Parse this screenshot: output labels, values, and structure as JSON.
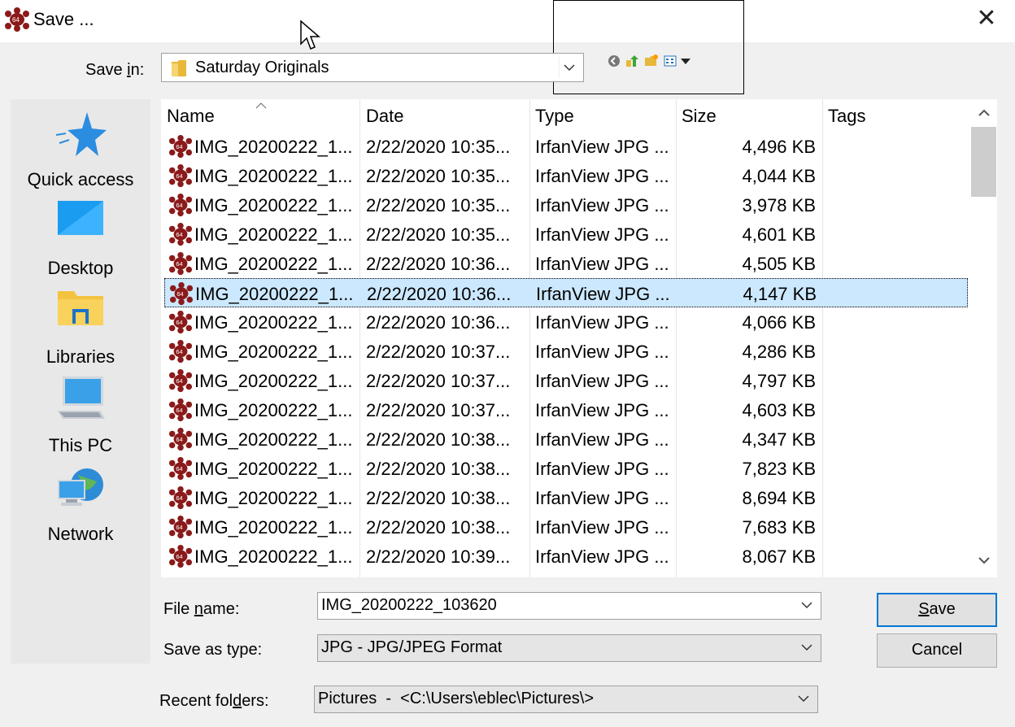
{
  "window": {
    "title": "Save ...",
    "close_label": "✕"
  },
  "save_in": {
    "label_pre": "Save ",
    "label_key": "i",
    "label_post": "n:",
    "value": "Saturday Originals"
  },
  "toolbar": {
    "icons": [
      "back-icon",
      "up-folder-icon",
      "new-folder-icon",
      "view-menu-icon"
    ]
  },
  "places": [
    {
      "label": "Quick access",
      "icon": "star-icon"
    },
    {
      "label": "Desktop",
      "icon": "desktop-icon"
    },
    {
      "label": "Libraries",
      "icon": "libraries-icon"
    },
    {
      "label": "This PC",
      "icon": "computer-icon"
    },
    {
      "label": "Network",
      "icon": "network-icon"
    }
  ],
  "columns": [
    "Name",
    "Date",
    "Type",
    "Size",
    "Tags"
  ],
  "files": [
    {
      "name": "IMG_20200222_1...",
      "date": "2/22/2020 10:35...",
      "type": "IrfanView JPG ...",
      "size": "4,496 KB"
    },
    {
      "name": "IMG_20200222_1...",
      "date": "2/22/2020 10:35...",
      "type": "IrfanView JPG ...",
      "size": "4,044 KB"
    },
    {
      "name": "IMG_20200222_1...",
      "date": "2/22/2020 10:35...",
      "type": "IrfanView JPG ...",
      "size": "3,978 KB"
    },
    {
      "name": "IMG_20200222_1...",
      "date": "2/22/2020 10:35...",
      "type": "IrfanView JPG ...",
      "size": "4,601 KB"
    },
    {
      "name": "IMG_20200222_1...",
      "date": "2/22/2020 10:36...",
      "type": "IrfanView JPG ...",
      "size": "4,505 KB"
    },
    {
      "name": "IMG_20200222_1...",
      "date": "2/22/2020 10:36...",
      "type": "IrfanView JPG ...",
      "size": "4,147 KB",
      "selected": true
    },
    {
      "name": "IMG_20200222_1...",
      "date": "2/22/2020 10:36...",
      "type": "IrfanView JPG ...",
      "size": "4,066 KB"
    },
    {
      "name": "IMG_20200222_1...",
      "date": "2/22/2020 10:37...",
      "type": "IrfanView JPG ...",
      "size": "4,286 KB"
    },
    {
      "name": "IMG_20200222_1...",
      "date": "2/22/2020 10:37...",
      "type": "IrfanView JPG ...",
      "size": "4,797 KB"
    },
    {
      "name": "IMG_20200222_1...",
      "date": "2/22/2020 10:37...",
      "type": "IrfanView JPG ...",
      "size": "4,603 KB"
    },
    {
      "name": "IMG_20200222_1...",
      "date": "2/22/2020 10:38...",
      "type": "IrfanView JPG ...",
      "size": "4,347 KB"
    },
    {
      "name": "IMG_20200222_1...",
      "date": "2/22/2020 10:38...",
      "type": "IrfanView JPG ...",
      "size": "7,823 KB"
    },
    {
      "name": "IMG_20200222_1...",
      "date": "2/22/2020 10:38...",
      "type": "IrfanView JPG ...",
      "size": "8,694 KB"
    },
    {
      "name": "IMG_20200222_1...",
      "date": "2/22/2020 10:38...",
      "type": "IrfanView JPG ...",
      "size": "7,683 KB"
    },
    {
      "name": "IMG_20200222_1...",
      "date": "2/22/2020 10:39...",
      "type": "IrfanView JPG ...",
      "size": "8,067 KB"
    }
  ],
  "file_name": {
    "label_pre": "File ",
    "label_key": "n",
    "label_post": "ame:",
    "value": "IMG_20200222_103620"
  },
  "save_as_type": {
    "label": "Save as type:",
    "value": "JPG - JPG/JPEG Format"
  },
  "recent_folders": {
    "label_pre": "Recent fol",
    "label_key": "d",
    "label_post": "ers:",
    "value": "Pictures  -  <C:\\Users\\eblec\\Pictures\\>"
  },
  "buttons": {
    "save_key": "S",
    "save_rest": "ave",
    "cancel": "Cancel"
  },
  "colors": {
    "selection": "#cce8ff",
    "accent": "#0078d7",
    "irfan_red": "#8b1a1a"
  }
}
